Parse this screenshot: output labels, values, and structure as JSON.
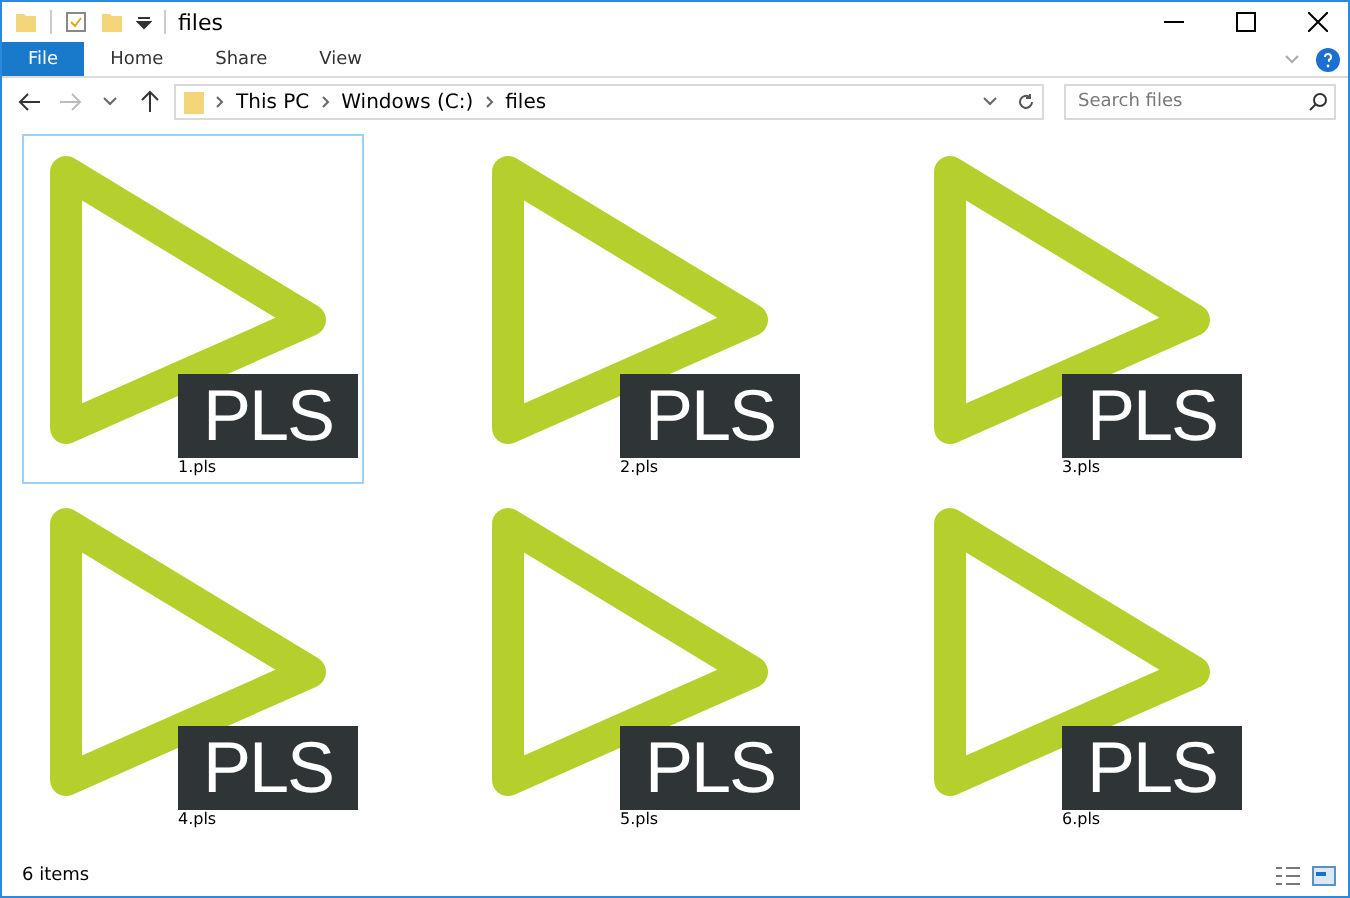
{
  "window": {
    "title": "files"
  },
  "ribbon_tabs": [
    {
      "label": "File",
      "selected": true
    },
    {
      "label": "Home",
      "selected": false
    },
    {
      "label": "Share",
      "selected": false
    },
    {
      "label": "View",
      "selected": false
    }
  ],
  "breadcrumb": [
    "This PC",
    "Windows (C:)",
    "files"
  ],
  "search": {
    "placeholder": "Search files"
  },
  "files": [
    {
      "name": "1.pls",
      "badge": "PLS",
      "selected": true
    },
    {
      "name": "2.pls",
      "badge": "PLS",
      "selected": false
    },
    {
      "name": "3.pls",
      "badge": "PLS",
      "selected": false
    },
    {
      "name": "4.pls",
      "badge": "PLS",
      "selected": false
    },
    {
      "name": "5.pls",
      "badge": "PLS",
      "selected": false
    },
    {
      "name": "6.pls",
      "badge": "PLS",
      "selected": false
    }
  ],
  "status_bar": {
    "count": "6 items"
  }
}
